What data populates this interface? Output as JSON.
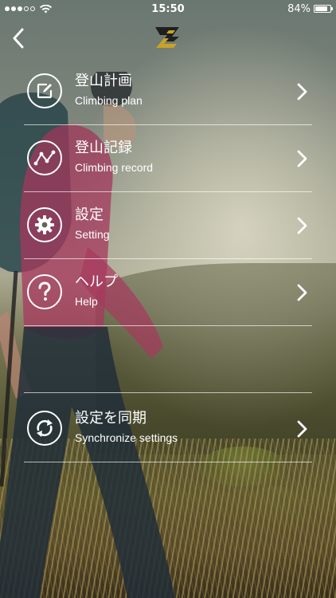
{
  "status_bar": {
    "time": "15:50",
    "battery_percent": "84%",
    "battery_level": 0.84,
    "signal_strength": 3,
    "signal_max": 5
  },
  "nav": {
    "back_icon": "chevron-left-icon",
    "logo_icon": "app-logo"
  },
  "menu": {
    "items": [
      {
        "title": "登山計画",
        "subtitle": "Climbing plan",
        "icon": "edit-note-icon"
      },
      {
        "title": "登山記録",
        "subtitle": "Climbing record",
        "icon": "route-graph-icon"
      },
      {
        "title": "設定",
        "subtitle": "Setting",
        "icon": "gear-icon"
      },
      {
        "title": "ヘルプ",
        "subtitle": "Help",
        "icon": "question-icon"
      }
    ],
    "sync": {
      "title": "設定を同期",
      "subtitle": "Synchronize settings",
      "icon": "sync-icon"
    }
  },
  "colors": {
    "text": "#ffffff",
    "logo_dark": "#1f1f1f",
    "logo_gold": "#c9a227",
    "divider": "rgba(255,255,255,0.65)"
  }
}
